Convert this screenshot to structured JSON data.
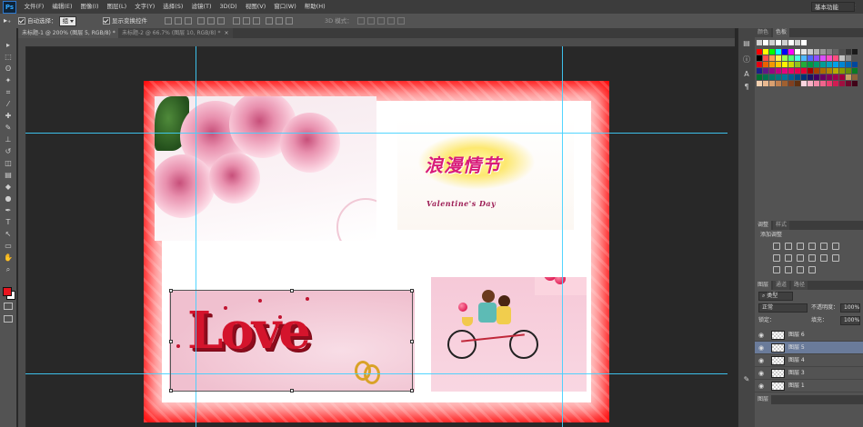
{
  "app": {
    "logo": "Ps"
  },
  "menubar": {
    "items": [
      "文件(F)",
      "编辑(E)",
      "图像(I)",
      "图层(L)",
      "文字(Y)",
      "选择(S)",
      "滤镜(T)",
      "3D(D)",
      "视图(V)",
      "窗口(W)",
      "帮助(H)"
    ],
    "window_controls": {
      "minimize": "–",
      "maximize": "□",
      "close": "✕"
    }
  },
  "options_bar": {
    "auto_select_label": "自动选择：",
    "auto_select_value": "组",
    "show_transform_label": "显示变换控件",
    "mode_3d_label": "3D 模式：",
    "workspace": "基本功能"
  },
  "tabs": [
    {
      "label": "未标题-1 @ 200% (图层 5, RGB/8) *",
      "close": "×"
    },
    {
      "label": "未标题-2 @ 66.7% (图层 10, RGB/8) *",
      "close": "×"
    }
  ],
  "tools": [
    "move-tool-icon",
    "marquee-tool-icon",
    "lasso-tool-icon",
    "quick-select-tool-icon",
    "crop-tool-icon",
    "eyedropper-tool-icon",
    "healing-tool-icon",
    "brush-tool-icon",
    "stamp-tool-icon",
    "history-brush-icon",
    "eraser-tool-icon",
    "gradient-tool-icon",
    "blur-tool-icon",
    "dodge-tool-icon",
    "pen-tool-icon",
    "type-tool-icon",
    "path-select-tool-icon",
    "shape-tool-icon",
    "hand-tool-icon",
    "zoom-tool-icon"
  ],
  "tool_glyphs": [
    "▸",
    "⬚",
    "ʘ",
    "✦",
    "⌗",
    "⁄",
    "✚",
    "✎",
    "⊥",
    "↺",
    "◫",
    "▤",
    "◆",
    "●",
    "✒",
    "T",
    "↖",
    "▭",
    "✋",
    "⌕"
  ],
  "canvas_content": {
    "valentine_cn": "浪漫情节",
    "valentine_en": "Valentine's Day",
    "love": "Love"
  },
  "panels": {
    "color_tabs": [
      "颜色",
      "色板"
    ],
    "adjust_tabs": [
      "调整",
      "样式"
    ],
    "adjust_title": "添加调整",
    "layers_tabs": [
      "图层",
      "通道",
      "路径"
    ],
    "kind_label": "类型",
    "blend_mode": "正常",
    "opacity_label": "不透明度：",
    "opacity_value": "100%",
    "lock_label": "锁定：",
    "fill_label": "填充：",
    "fill_value": "100%",
    "layers": [
      {
        "name": "图层 6",
        "selected": false
      },
      {
        "name": "图层 5",
        "selected": true
      },
      {
        "name": "图层 4",
        "selected": false
      },
      {
        "name": "图层 3",
        "selected": false
      },
      {
        "name": "图层 1",
        "selected": false
      }
    ],
    "layers_footer": "图层"
  },
  "colors": {
    "foreground": "#e8141e",
    "background": "#ffffff",
    "canvas_frame": "#ff0000",
    "guide": "#3fd0ff",
    "selected_layer": "#6a7b9a"
  }
}
